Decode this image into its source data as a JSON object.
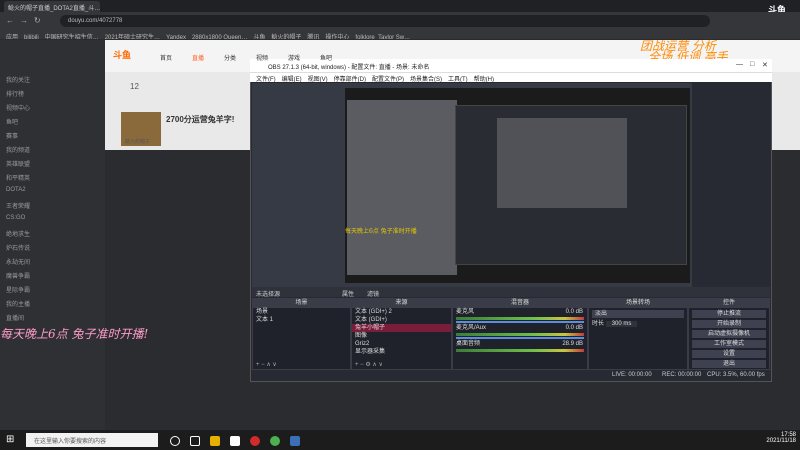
{
  "browser": {
    "tab_title": "鲶火的帽子直播_DOTA2直播_斗…",
    "url": "douyu.com/4072778",
    "bookmarks": [
      "应用",
      "bilibili",
      "中国研究生招生信…",
      "2021年硕士研究生…",
      "Yandex",
      "2880x1800 Queen…",
      "斗鱼",
      "鲶火的帽子",
      "腾讯",
      "操作中心",
      "folklore_Taylor Sw…"
    ]
  },
  "site": {
    "brand": "斗鱼",
    "logo": "斗鱼",
    "top_nav": [
      "首页",
      "直播",
      "分类",
      "视频",
      "游戏",
      "鱼吧"
    ],
    "sidebar": [
      "我的关注",
      "排行榜",
      "视频中心",
      "鱼吧",
      "赛事",
      "我的频道",
      "英雄联盟",
      "和平精英",
      "DOTA2",
      "王者荣耀",
      "CS:GO",
      "绝地求生",
      "炉石传说",
      "永劫无间",
      "魔兽争霸",
      "星际争霸",
      "我的主播",
      "直播间"
    ],
    "stream": {
      "title": "2700分运营兔羊字!",
      "level": "12",
      "streamer": "鲶火的帽子"
    },
    "overlay_left": "每天晚上6点 兔子准时开播!",
    "overlay_right_line1": "团战运营 分析",
    "overlay_right_line2": "全场 低调 高手"
  },
  "obs": {
    "title": "OBS 27.1.3 (64-bit, windows) - 配置文件: 直播 - 场景: 未命名",
    "menu": [
      "文件(F)",
      "编辑(E)",
      "视图(V)",
      "停靠部件(D)",
      "配置文件(P)",
      "场景集合(S)",
      "工具(T)",
      "帮助(H)"
    ],
    "preview_annotation": "每天晚上6点 兔子准时开播",
    "control_bar": {
      "scene_label": "未选择源",
      "props": "属性",
      "filters": "滤镜"
    },
    "docks": {
      "scenes": {
        "header": "场景",
        "items": [
          "场景",
          "文本 1"
        ]
      },
      "sources": {
        "header": "来源",
        "items": [
          "文本 (GDI+) 2",
          "文本 (GDI+)",
          "兔羊小帽子",
          "图像",
          "Griz2",
          "显示器采集"
        ]
      },
      "mixer": {
        "header": "混音器",
        "channels": [
          {
            "name": "麦克风",
            "db": "0.0 dB"
          },
          {
            "name": "麦克风/Aux",
            "db": "0.0 dB"
          },
          {
            "name": "桌面音频",
            "db": "28.9 dB"
          }
        ]
      },
      "transitions": {
        "header": "场景转场",
        "type": "淡出",
        "duration_label": "时长",
        "duration_value": "300 ms"
      },
      "controls": {
        "header": "控件",
        "buttons": [
          "停止推流",
          "开始录制",
          "启动虚拟摄像机",
          "工作室模式",
          "设置",
          "退出"
        ]
      }
    },
    "status": {
      "live": "LIVE: 00:00:00",
      "rec": "REC: 00:00:00",
      "cpu": "CPU: 3.5%, 60.00 fps"
    }
  },
  "taskbar": {
    "search_placeholder": "在这里输入你要搜索的内容",
    "time": "17:58",
    "date": "2021/11/18"
  }
}
